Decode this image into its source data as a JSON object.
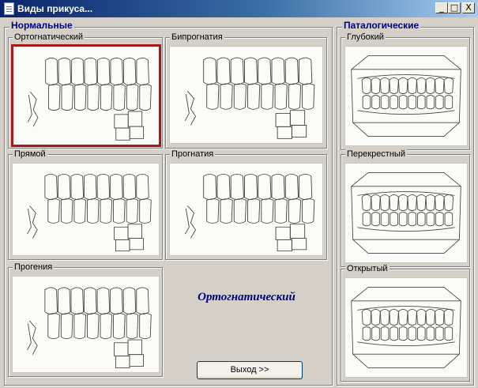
{
  "window": {
    "title": "Виды прикуса...",
    "buttons": {
      "minimize": "_",
      "maximize": "□",
      "close": "X"
    }
  },
  "groups": {
    "normal": "Нормальные",
    "pathological": "Паталогические"
  },
  "panels": [
    {
      "id": "orthognathic",
      "label": "Ортогнатический",
      "selected": true,
      "type": "side"
    },
    {
      "id": "biprognathia",
      "label": "Бипрогнатия",
      "selected": false,
      "type": "side"
    },
    {
      "id": "straight",
      "label": "Прямой",
      "selected": false,
      "type": "side"
    },
    {
      "id": "prognathia",
      "label": "Прогнатия",
      "selected": false,
      "type": "side"
    },
    {
      "id": "progenia",
      "label": "Прогения",
      "selected": false,
      "type": "side"
    },
    {
      "id": "deep",
      "label": "Глубокий",
      "selected": false,
      "type": "front"
    },
    {
      "id": "cross",
      "label": "Перекрестный",
      "selected": false,
      "type": "front"
    },
    {
      "id": "open",
      "label": "Открытый",
      "selected": false,
      "type": "front"
    }
  ],
  "selected_name": "Ортогнатический",
  "exit_button": "Выход >>",
  "colors": {
    "accent": "#000080",
    "selection": "#a51a1a",
    "titlebar": "#0a246a"
  }
}
